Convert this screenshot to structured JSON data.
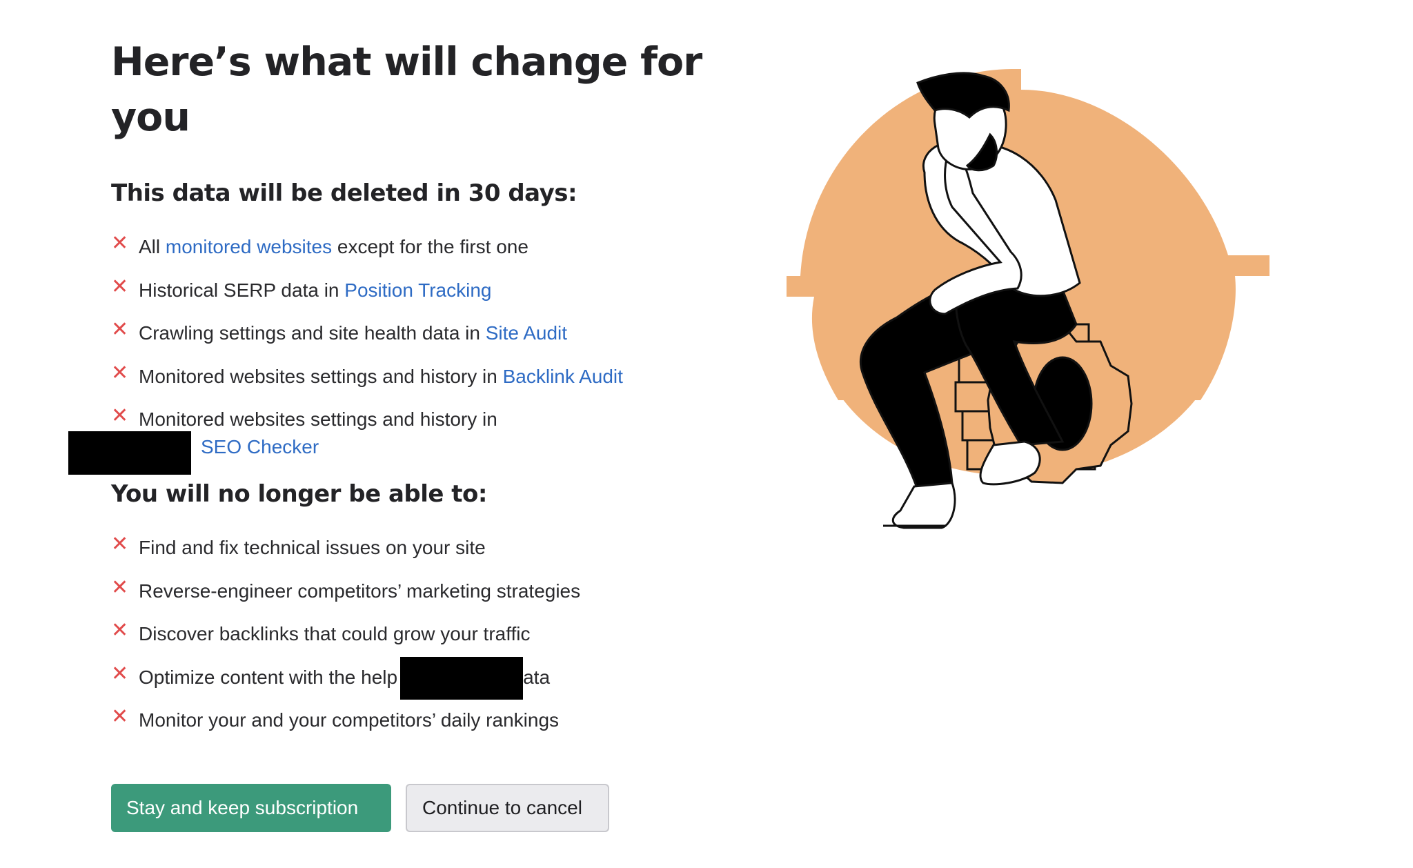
{
  "title": "Here’s what will change for you",
  "sections": [
    {
      "title": "This data will be deleted in 30 days:",
      "items": [
        {
          "before": "All ",
          "link": "monitored websites",
          "after": " except for the first one"
        },
        {
          "before": "Historical SERP data in ",
          "link": "Position Tracking",
          "after": ""
        },
        {
          "before": "Crawling settings and site health data in ",
          "link": "Site Audit",
          "after": ""
        },
        {
          "before": "Monitored websites settings and history in ",
          "link": "Backlink Audit",
          "after": ""
        },
        {
          "before": "Monitored websites settings and history in",
          "link": "SEO Checker",
          "after": ""
        }
      ]
    },
    {
      "title": "You will no longer be able to:",
      "items": [
        {
          "text": "Find and fix technical issues on your site"
        },
        {
          "text": "Reverse-engineer competitors’ marketing strategies"
        },
        {
          "text": "Discover backlinks that could grow your traffic"
        },
        {
          "before": "Optimize content with the help",
          "after": "ata"
        },
        {
          "text": "Monitor your and your competitors’ daily rankings"
        }
      ]
    }
  ],
  "buttons": {
    "primary": "Stay and keep subscription",
    "secondary": "Continue to cancel"
  },
  "icons": {
    "list_marker": "close-x-icon",
    "illustration": "thinking-man-on-gear-illustration"
  },
  "colors": {
    "link": "#2e6bc4",
    "x_mark": "#e14b4b",
    "primary_button": "#3c9a7b",
    "illustration_accent": "#f0b27a"
  }
}
